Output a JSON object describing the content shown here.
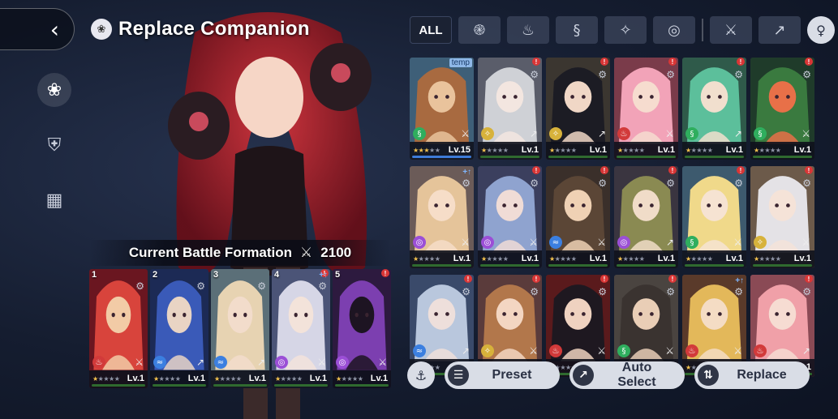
{
  "header": {
    "back_icon": "chevron-left-icon",
    "title_icon": "companion-emblem-icon",
    "title": "Replace Companion"
  },
  "side_nav": [
    {
      "icon": "companion-emblem-icon",
      "active": true
    },
    {
      "icon": "star-shield-icon",
      "active": false
    },
    {
      "icon": "grid-icon",
      "active": false
    }
  ],
  "formation": {
    "label": "Current Battle Formation",
    "power": "2100",
    "power_icon": "crossed-swords-icon",
    "members": [
      {
        "slot": "1",
        "element": "fire",
        "weapon": "sword",
        "stars": 1,
        "level": "Lv.1",
        "palette": [
          "#6a1620",
          "#d8443c",
          "#f2cba6"
        ],
        "gear": true,
        "alert": false
      },
      {
        "slot": "2",
        "element": "water",
        "weapon": "spear",
        "stars": 1,
        "level": "Lv.1",
        "palette": [
          "#1c2a55",
          "#3a5ab8",
          "#e9d4c4"
        ],
        "gear": true,
        "alert": false
      },
      {
        "slot": "3",
        "element": "water",
        "weapon": "spear",
        "stars": 1,
        "level": "Lv.1",
        "palette": [
          "#5b6f78",
          "#e7d3b2",
          "#f2dccb"
        ],
        "gear": true,
        "alert": false
      },
      {
        "slot": "4",
        "element": "void",
        "weapon": "sword",
        "stars": 1,
        "level": "Lv.1",
        "palette": [
          "#4b5477",
          "#d6d6e6",
          "#f3e3da"
        ],
        "gear": true,
        "alert": true,
        "boost": true
      },
      {
        "slot": "5",
        "element": "void",
        "weapon": "sword",
        "stars": 1,
        "level": "Lv.1",
        "palette": [
          "#2d1a3f",
          "#7c3fb0",
          "#1d1422"
        ],
        "gear": false,
        "alert": true
      }
    ]
  },
  "filters": [
    {
      "label": "ALL",
      "icon": null,
      "selected": true
    },
    {
      "label": "",
      "icon": "wind-element-icon"
    },
    {
      "label": "",
      "icon": "fire-element-icon"
    },
    {
      "label": "",
      "icon": "nature-element-icon"
    },
    {
      "label": "",
      "icon": "light-element-icon"
    },
    {
      "label": "",
      "icon": "void-element-icon"
    },
    {
      "label": "",
      "icon": "sword-weapon-icon"
    },
    {
      "label": "",
      "icon": "spear-weapon-icon"
    }
  ],
  "filter_sort_icon": "sort-order-icon",
  "roster": [
    {
      "element": "nature",
      "weapon": "sword",
      "stars": 3,
      "level": "Lv.15",
      "palette": [
        "#3e5f78",
        "#a86a40",
        "#e9c39c"
      ],
      "tag": "temp",
      "xp": "blue"
    },
    {
      "element": "light",
      "weapon": "spear",
      "stars": 1,
      "level": "Lv.1",
      "palette": [
        "#5a5d6a",
        "#cfd1d6",
        "#f3e6e0"
      ],
      "alert": true,
      "gear": true
    },
    {
      "element": "light",
      "weapon": "spear",
      "stars": 1,
      "level": "Lv.1",
      "palette": [
        "#3b3630",
        "#1c1c24",
        "#f0d7c6"
      ],
      "alert": true,
      "gear": true
    },
    {
      "element": "fire",
      "weapon": "sword",
      "stars": 1,
      "level": "Lv.1",
      "palette": [
        "#7a3b4a",
        "#f2a3b8",
        "#f6dccf"
      ],
      "alert": true,
      "gear": true
    },
    {
      "element": "nature",
      "weapon": "spear",
      "stars": 1,
      "level": "Lv.1",
      "palette": [
        "#2f5a4a",
        "#5cbf9b",
        "#f1dfce"
      ],
      "alert": true,
      "gear": true
    },
    {
      "element": "nature",
      "weapon": "sword",
      "stars": 1,
      "level": "Lv.1",
      "palette": [
        "#1f3b2a",
        "#3a7a3f",
        "#e87048"
      ],
      "alert": true,
      "gear": true
    },
    {
      "element": "void",
      "weapon": "sword",
      "stars": 1,
      "level": "Lv.1",
      "palette": [
        "#6b5b58",
        "#e5c49a",
        "#f6ddc8"
      ],
      "boost": true,
      "gear": true
    },
    {
      "element": "void",
      "weapon": "sword",
      "stars": 1,
      "level": "Lv.1",
      "palette": [
        "#3b3f5e",
        "#8fa3cf",
        "#f0dcd6"
      ],
      "alert": true,
      "gear": true
    },
    {
      "element": "water",
      "weapon": "sword",
      "stars": 1,
      "level": "Lv.1",
      "palette": [
        "#3a2f2a",
        "#5b4636",
        "#efd1b4"
      ],
      "alert": true,
      "gear": true
    },
    {
      "element": "void",
      "weapon": "spear",
      "stars": 1,
      "level": "Lv.1",
      "palette": [
        "#3a3540",
        "#8a8a52",
        "#f0dcc8"
      ],
      "alert": true,
      "gear": true
    },
    {
      "element": "nature",
      "weapon": "sword",
      "stars": 1,
      "level": "Lv.1",
      "palette": [
        "#3d5a6e",
        "#f0d98a",
        "#f6e3d2"
      ],
      "alert": true,
      "gear": true
    },
    {
      "element": "light",
      "weapon": "sword",
      "stars": 1,
      "level": "Lv.1",
      "palette": [
        "#6c5a4a",
        "#e4e2e6",
        "#f5e3d8"
      ],
      "alert": true,
      "gear": true
    },
    {
      "element": "water",
      "weapon": "spear",
      "stars": 1,
      "level": "Lv.1",
      "palette": [
        "#3a4a6a",
        "#b9c7dd",
        "#eedfdb"
      ],
      "alert": true,
      "gear": true
    },
    {
      "element": "light",
      "weapon": "sword",
      "stars": 1,
      "level": "Lv.1",
      "palette": [
        "#5a3b3b",
        "#b2774b",
        "#f3d6c2"
      ],
      "alert": true,
      "gear": true
    },
    {
      "element": "fire",
      "weapon": "sword",
      "stars": 1,
      "level": "Lv.1",
      "palette": [
        "#5a1a1c",
        "#1e1820",
        "#efd2c0"
      ],
      "alert": true,
      "gear": true
    },
    {
      "element": "nature",
      "weapon": "sword",
      "stars": 1,
      "level": "Lv.1",
      "palette": [
        "#4a4440",
        "#3a3330",
        "#e9ceb6"
      ],
      "alert": true,
      "gear": true
    },
    {
      "element": "fire",
      "weapon": "sword",
      "stars": 1,
      "level": "Lv.1",
      "palette": [
        "#5a3a2a",
        "#e3b85a",
        "#f4dcc4"
      ],
      "boost": true,
      "gear": true
    },
    {
      "element": "fire",
      "weapon": "spear",
      "stars": 1,
      "level": "Lv.1",
      "palette": [
        "#8a4a55",
        "#f0a0a8",
        "#f6dcd2"
      ],
      "alert": true,
      "gear": true
    }
  ],
  "actions": {
    "filter_icon": "fork-knife-icon",
    "preset": {
      "label": "Preset",
      "icon": "layers-icon"
    },
    "auto_select": {
      "label": "Auto Select",
      "icon": "auto-arrow-icon"
    },
    "replace": {
      "label": "Replace",
      "icon": "swap-icon"
    }
  },
  "colors": {
    "fire": "#d23a3a",
    "water": "#3b7fe0",
    "nature": "#2fae5e",
    "light": "#d7b23b",
    "void": "#9b4fd6",
    "star": "#f2c14e"
  }
}
